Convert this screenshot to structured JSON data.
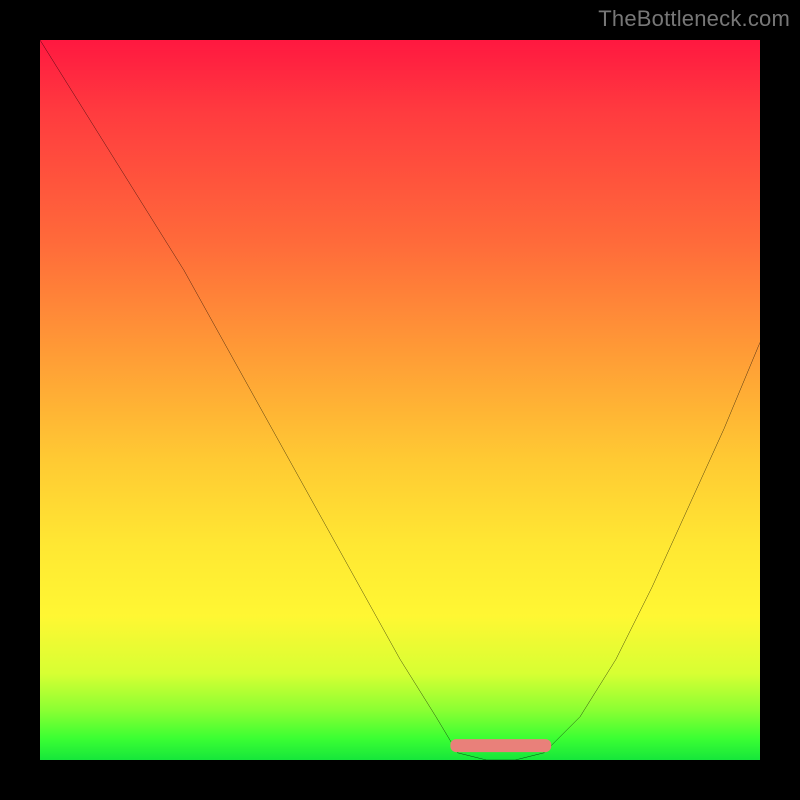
{
  "watermark": {
    "text": "TheBottleneck.com"
  },
  "chart_data": {
    "type": "line",
    "title": "",
    "xlabel": "",
    "ylabel": "",
    "xlim": [
      0,
      100
    ],
    "ylim": [
      0,
      100
    ],
    "background_gradient": {
      "orientation": "vertical",
      "stops": [
        {
          "pos": 0,
          "color": "#ff1840"
        },
        {
          "pos": 10,
          "color": "#ff3b3f"
        },
        {
          "pos": 28,
          "color": "#ff6a3a"
        },
        {
          "pos": 44,
          "color": "#ff9d36"
        },
        {
          "pos": 58,
          "color": "#ffc933"
        },
        {
          "pos": 70,
          "color": "#ffe733"
        },
        {
          "pos": 80,
          "color": "#fff733"
        },
        {
          "pos": 88,
          "color": "#d7ff33"
        },
        {
          "pos": 93,
          "color": "#8cff33"
        },
        {
          "pos": 97,
          "color": "#3bff33"
        },
        {
          "pos": 100,
          "color": "#16e63b"
        }
      ]
    },
    "series": [
      {
        "name": "bottleneck-curve",
        "color": "#000000",
        "x": [
          0,
          5,
          10,
          15,
          20,
          25,
          30,
          35,
          40,
          45,
          50,
          55,
          58,
          62,
          66,
          70,
          75,
          80,
          85,
          90,
          95,
          100
        ],
        "y": [
          100,
          92,
          84,
          76,
          68,
          59,
          50,
          41,
          32,
          23,
          14,
          6,
          1,
          0,
          0,
          1,
          6,
          14,
          24,
          35,
          46,
          58
        ]
      },
      {
        "name": "optimal-range-marker",
        "color": "#e9807a",
        "marker": "rounded-bar",
        "x": [
          57,
          71
        ],
        "y": [
          2,
          2
        ]
      }
    ]
  }
}
